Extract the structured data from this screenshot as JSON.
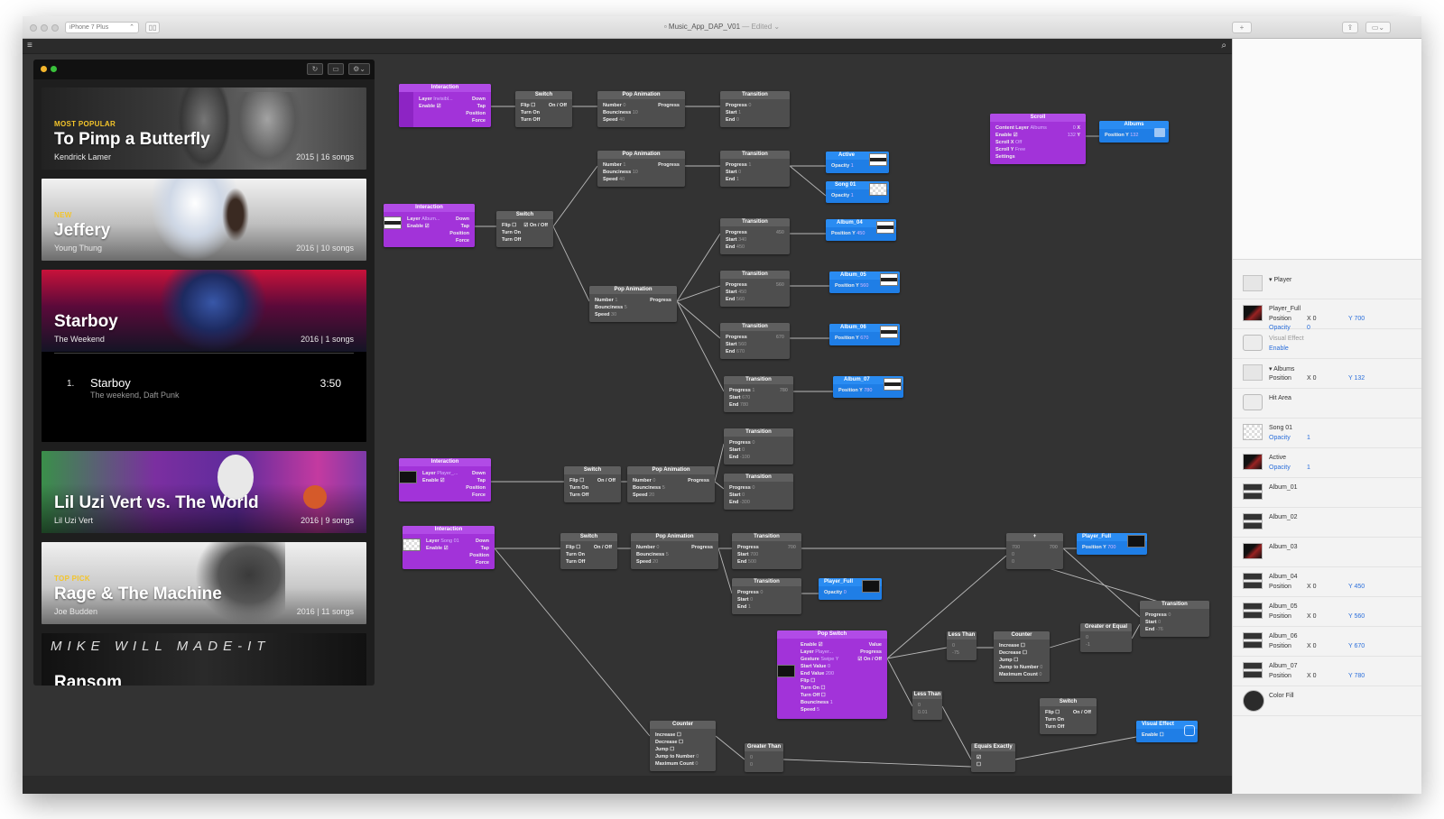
{
  "window": {
    "device": "iPhone 7 Plus",
    "doc_title": "Music_App_DAP_V01",
    "doc_state": "— Edited ⌄"
  },
  "viewer": {
    "cards": [
      {
        "tag": "MOST POPULAR",
        "title": "To Pimp a Butterfly",
        "artist": "Kendrick Lamer",
        "meta": "2015 | 16 songs"
      },
      {
        "tag": "NEW",
        "title": "Jeffery",
        "artist": "Young Thung",
        "meta": "2016 | 10 songs"
      },
      {
        "tag": "",
        "title": "Starboy",
        "artist": "The Weekend",
        "meta": "2016 | 1 songs"
      },
      {
        "tag": "",
        "title": "Lil Uzi Vert vs. The World",
        "artist": "Lil Uzi Vert",
        "meta": "2016 | 9 songs"
      },
      {
        "tag": "TOP PICK",
        "title": "Rage & The Machine",
        "artist": "Joe Budden",
        "meta": "2016 | 11 songs"
      },
      {
        "tag": "",
        "title": "Ransom",
        "artist": "",
        "meta": "",
        "banner": "MIKE WILL     MADE-IT"
      }
    ],
    "track": {
      "num": "1.",
      "title": "Starboy",
      "sub": "The weekend, Daft Punk",
      "duration": "3:50"
    }
  },
  "nodes": {
    "interaction": "Interaction",
    "switch": "Switch",
    "pop_animation": "Pop Animation",
    "transition": "Transition",
    "scroll": "Scroll",
    "counter": "Counter",
    "greater_than": "Greater Than",
    "less_than": "Less Than",
    "greater_or_equal": "Greater or Equal",
    "equals_exactly": "Equals Exactly",
    "pop_switch": "Pop Switch",
    "plus": "+",
    "visual_effect": "Visual Effect",
    "active": "Active",
    "song01": "Song 01",
    "albums": "Albums",
    "album_04": "Album_04",
    "album_05": "Album_05",
    "album_06": "Album_06",
    "album_07": "Album_07",
    "player_full": "Player_Full"
  },
  "ports": {
    "layer": "Layer",
    "enable": "Enable",
    "down": "Down",
    "tap": "Tap",
    "position": "Position",
    "force": "Force",
    "flip": "Flip",
    "turn_on": "Turn On",
    "turn_off": "Turn Off",
    "on_off": "On / Off",
    "number": "Number",
    "bounciness": "Bounciness",
    "speed": "Speed",
    "progress": "Progress",
    "start": "Start",
    "end": "End",
    "opacity": "Opacity",
    "position_y": "Position Y",
    "content_layer": "Content Layer",
    "scroll_x": "Scroll X",
    "scroll_y": "Scroll Y",
    "settings": "Settings",
    "increase": "Increase",
    "decrease": "Decrease",
    "jump": "Jump",
    "jump_to_number": "Jump to Number",
    "maximum_count": "Maximum Count",
    "gesture": "Gesture",
    "start_value": "Start Value",
    "end_value": "End Value",
    "value": "Value",
    "x": "X",
    "y": "Y"
  },
  "values": {
    "layer_invisible": "Invisibl...",
    "layer_album": "Album...",
    "layer_player": "Player_...",
    "layer_song": "Song 01",
    "albums": "Albums",
    "off": "Off",
    "free": "Free",
    "swipe_y": "Swipe Y",
    "player": "Player...",
    "n0": "0",
    "n1": "1",
    "n5": "5",
    "n10": "10",
    "n20": "20",
    "n30": "30",
    "n40": "40",
    "n50": "50",
    "n132": "132",
    "n200": "200",
    "n340": "340",
    "n450": "450",
    "n560": "560",
    "n670": "670",
    "n700": "700",
    "n780": "780",
    "nm75": "-75",
    "nm76": "-76",
    "nm100": "-100",
    "nm300": "-300",
    "n001": "0.01",
    "nm1": "-1"
  },
  "inspector": {
    "layers": [
      {
        "name": "▾ Player",
        "kind": "folder"
      },
      {
        "name": "Player_Full",
        "props": [
          [
            "Position",
            "X 0",
            "Y 700"
          ],
          [
            "Opacity",
            "0",
            ""
          ]
        ],
        "kind": "dark"
      },
      {
        "name": "Visual Effect",
        "props": [
          [
            "Enable",
            "",
            ""
          ]
        ],
        "kind": "circ",
        "faded": true
      },
      {
        "name": "▾ Albums",
        "props": [
          [
            "Position",
            "X 0",
            "Y 132"
          ]
        ],
        "kind": "folder"
      },
      {
        "name": "Hit Area",
        "props": [],
        "kind": "circ"
      },
      {
        "name": "Song 01",
        "props": [
          [
            "Opacity",
            "1",
            ""
          ]
        ],
        "kind": "check"
      },
      {
        "name": "Active",
        "props": [
          [
            "Opacity",
            "1",
            ""
          ]
        ],
        "kind": "dark"
      },
      {
        "name": "Album_01",
        "props": [],
        "kind": "ablm"
      },
      {
        "name": "Album_02",
        "props": [],
        "kind": "ablm"
      },
      {
        "name": "Album_03",
        "props": [],
        "kind": "dark"
      },
      {
        "name": "Album_04",
        "props": [
          [
            "Position",
            "X 0",
            "Y 450"
          ]
        ],
        "kind": "ablm"
      },
      {
        "name": "Album_05",
        "props": [
          [
            "Position",
            "X 0",
            "Y 560"
          ]
        ],
        "kind": "ablm"
      },
      {
        "name": "Album_06",
        "props": [
          [
            "Position",
            "X 0",
            "Y 670"
          ]
        ],
        "kind": "ablm"
      },
      {
        "name": "Album_07",
        "props": [
          [
            "Position",
            "X 0",
            "Y 780"
          ]
        ],
        "kind": "ablm"
      },
      {
        "name": "Color Fill",
        "props": [],
        "kind": "colorfill"
      }
    ]
  },
  "colors": {
    "patch_purple": "#a233d9",
    "layer_blue": "#1f7ee6",
    "canvas": "#333333",
    "accent_yellow": "#f4c52a"
  }
}
